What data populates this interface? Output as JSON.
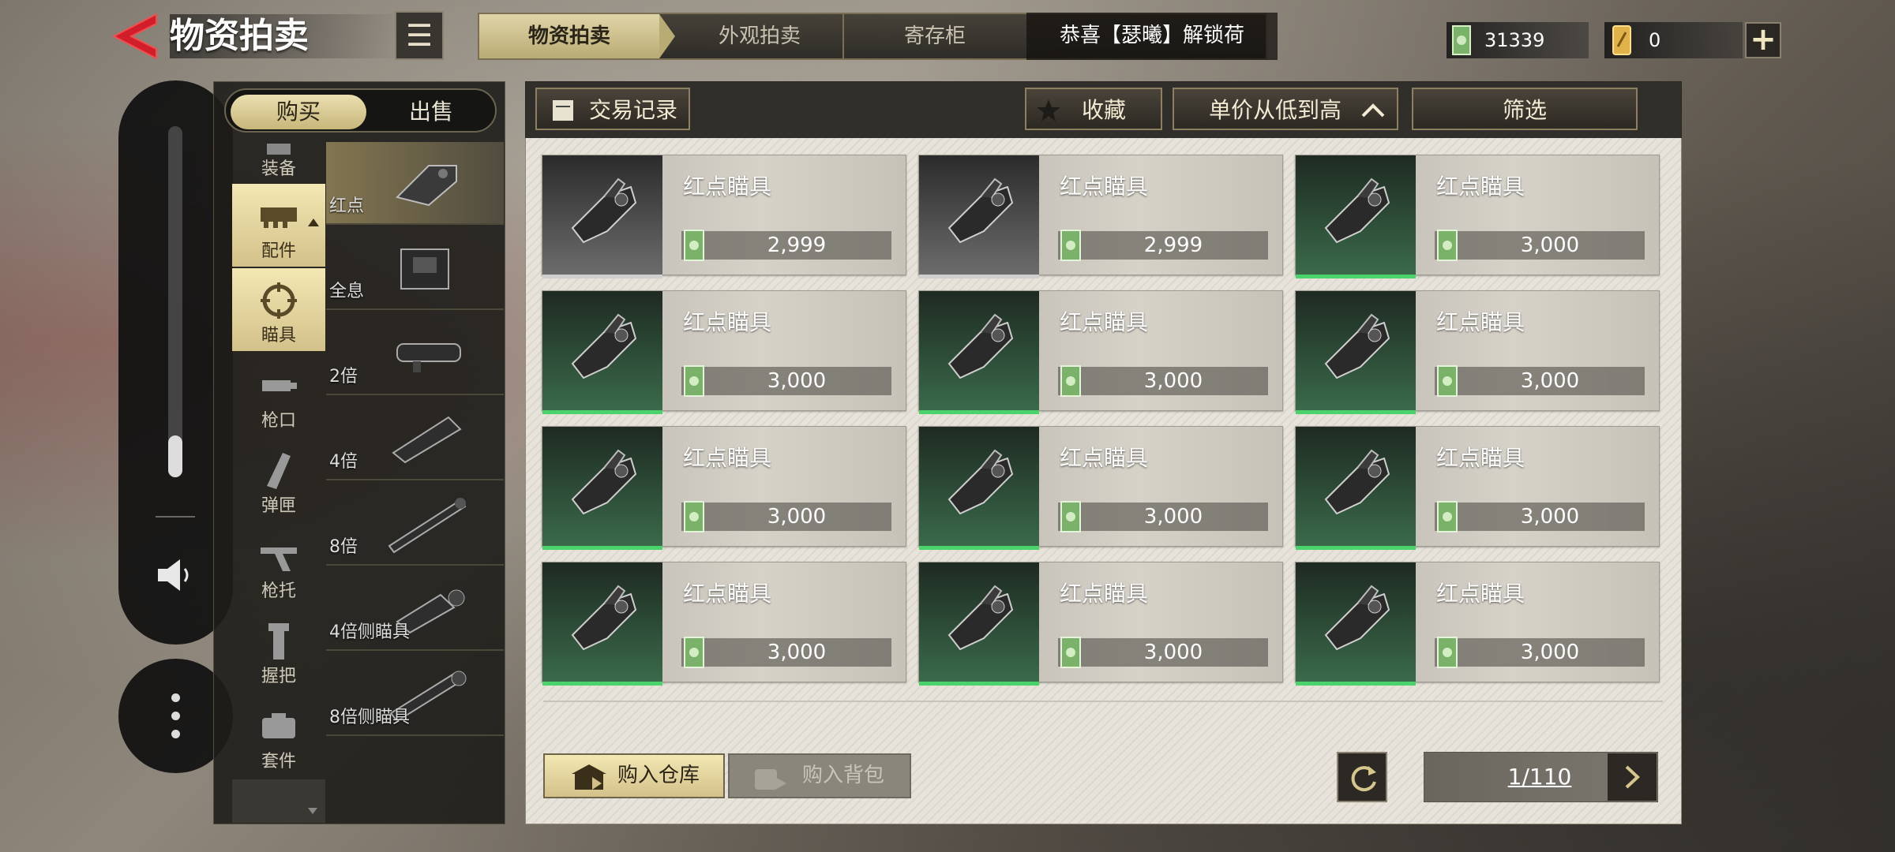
{
  "header": {
    "title": "物资拍卖",
    "tabs": [
      {
        "label": "物资拍卖",
        "active": true
      },
      {
        "label": "外观拍卖",
        "active": false
      },
      {
        "label": "寄存柜",
        "active": false
      }
    ],
    "marquee": "恭喜【瑟曦】解锁荷",
    "currency_cash": "31339",
    "currency_ticket": "0"
  },
  "left_panel": {
    "toggle": {
      "buy": "购买",
      "sell": "出售"
    },
    "categories": [
      {
        "label": "装备",
        "icon": "armor-icon"
      },
      {
        "label": "配件",
        "icon": "attachment-icon",
        "selected": true
      },
      {
        "label": "瞄具",
        "icon": "scope-icon",
        "selected": true
      },
      {
        "label": "枪口",
        "icon": "muzzle-icon"
      },
      {
        "label": "弹匣",
        "icon": "magazine-icon"
      },
      {
        "label": "枪托",
        "icon": "stock-icon"
      },
      {
        "label": "握把",
        "icon": "grip-icon"
      },
      {
        "label": "套件",
        "icon": "kit-icon"
      }
    ],
    "subcategories": [
      {
        "label": "红点",
        "selected": true
      },
      {
        "label": "全息"
      },
      {
        "label": "2倍"
      },
      {
        "label": "4倍"
      },
      {
        "label": "8倍"
      },
      {
        "label": "4倍侧瞄具"
      },
      {
        "label": "8倍侧瞄具"
      }
    ]
  },
  "toolbar": {
    "history": "交易记录",
    "favorite": "收藏",
    "sort": "单价从低到高",
    "filter": "筛选"
  },
  "items": [
    {
      "name": "红点瞄具",
      "price": "2,999",
      "rarity": "grey"
    },
    {
      "name": "红点瞄具",
      "price": "2,999",
      "rarity": "grey"
    },
    {
      "name": "红点瞄具",
      "price": "3,000",
      "rarity": "green"
    },
    {
      "name": "红点瞄具",
      "price": "3,000",
      "rarity": "green"
    },
    {
      "name": "红点瞄具",
      "price": "3,000",
      "rarity": "green"
    },
    {
      "name": "红点瞄具",
      "price": "3,000",
      "rarity": "green"
    },
    {
      "name": "红点瞄具",
      "price": "3,000",
      "rarity": "green"
    },
    {
      "name": "红点瞄具",
      "price": "3,000",
      "rarity": "green"
    },
    {
      "name": "红点瞄具",
      "price": "3,000",
      "rarity": "green"
    },
    {
      "name": "红点瞄具",
      "price": "3,000",
      "rarity": "green"
    },
    {
      "name": "红点瞄具",
      "price": "3,000",
      "rarity": "green"
    },
    {
      "name": "红点瞄具",
      "price": "3,000",
      "rarity": "green"
    }
  ],
  "footer": {
    "buy_storage": "购入仓库",
    "buy_backpack": "购入背包",
    "page": "1/110"
  },
  "colors": {
    "accent_gold": "#d3c18a",
    "rarity_green": "#49d36a",
    "back_red": "#d21e2a"
  }
}
